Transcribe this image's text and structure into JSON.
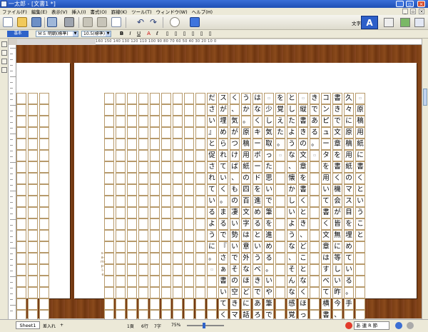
{
  "window": {
    "title": "一太郎 - [文書1 *]",
    "minimize_glyph": "_",
    "restore_glyph": "▫",
    "close_glyph": "×"
  },
  "menu": [
    "ファイル(F)",
    "編集(E)",
    "表示(V)",
    "挿入(I)",
    "書式(O)",
    "罫線(K)",
    "ツール(T)",
    "ウィンドウ(W)",
    "ヘルプ(H)"
  ],
  "menu_doc_buttons": [
    "_",
    "▫",
    "×"
  ],
  "toolbar": {
    "moji_label": "文字",
    "a_label": "A",
    "undo_glyph": "↶",
    "redo_glyph": "↷",
    "icons": [
      "new-document-icon",
      "open-folder-icon",
      "save-disk-icon",
      "print-icon",
      "scissors-icon",
      "copy-icon",
      "paste-icon",
      "undo-icon",
      "redo-icon",
      "search-icon",
      "refresh-icon"
    ]
  },
  "formatbar": {
    "style": "基本",
    "font": "ＭＳ 明朝(標準)",
    "size": "10.5(標準)",
    "bold": "B",
    "italic": "I",
    "underline": "U",
    "textcolor": "A",
    "marker": "ℓ"
  },
  "ruler": {
    "numbers": "160 150 140 130 120 110 100  90  80  70  60  50  40  30  20  10   0"
  },
  "document": {
    "columns": [
      {
        "text": "原稿用紙に書くということ",
        "lead_blank": true
      },
      {
        "text": "久々に原稿用紙のマス目を埋めている。手",
        "lead_blank": false
      },
      {
        "text": "書きで文章を書く機会が皆無に等しい昨今、",
        "lead_blank": false
      },
      {
        "text": "コンピュータを用いて書く文章はすべて横書",
        "lead_blank": false
      },
      {
        "text": "きである。",
        "lead_blank": false,
        "end_blank": true
      },
      {
        "text": "縦書きの文章を書くとき、どことなくほっ",
        "lead_blank": true
      },
      {
        "text": "としたような、懐かしいような、そんな感覚",
        "lead_blank": false
      },
      {
        "text": "を覚えた。",
        "lead_blank": false,
        "end_blank": true
      },
      {
        "text": "少し気取った思いで筆を進める。いや筆で",
        "lead_blank": true
      },
      {
        "text": "はなくキーボードを進めるというべきであろ",
        "lead_blank": false
      },
      {
        "text": "うか。原稿用紙の四百文字は意外なほどに話",
        "lead_blank": false
      },
      {
        "text": "く、気がつけば、もの凄い勢いでその空きマ",
        "lead_blank": false
      },
      {
        "text": "スが埋められていく。まるで『さぁ書いてく",
        "lead_blank": false
      },
      {
        "text": "ださい』と促されているように。",
        "lead_blank": false,
        "end_blank": true
      }
    ],
    "page_mark": "s-a-m-p-l-e"
  },
  "statusbar": {
    "sheet_tab": "Sheet1",
    "insert_label": "差入れ",
    "plus_glyph": "+",
    "page_info": "1頁",
    "line_info": "6行",
    "col_info": "7字",
    "zoom": "75%",
    "ime": "あ 連 R 節"
  }
}
